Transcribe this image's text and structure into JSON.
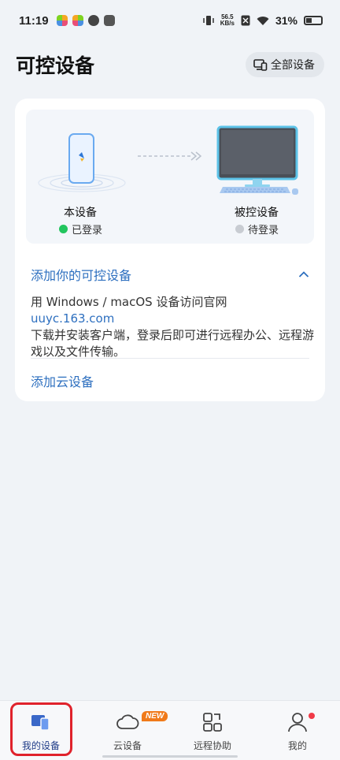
{
  "status_bar": {
    "time": "11:19",
    "net_speed_value": "56.5",
    "net_speed_unit": "KB/s",
    "battery": "31%"
  },
  "header": {
    "title": "可控设备",
    "all_devices_label": "全部设备"
  },
  "card": {
    "this_device_label": "本设备",
    "this_device_status": "已登录",
    "controlled_device_label": "被控设备",
    "controlled_device_status": "待登录",
    "add_controllable_title": "添加你的可控设备",
    "desc_prefix": "用 Windows / macOS 设备访问官网 ",
    "desc_link": "uuyc.163.com",
    "desc_suffix": "下载并安装客户端，登录后即可进行远程办公、远程游戏以及文件传输。",
    "add_cloud_label": "添加云设备"
  },
  "bottom_nav": {
    "items": [
      {
        "label": "我的设备"
      },
      {
        "label": "云设备"
      },
      {
        "label": "远程协助"
      },
      {
        "label": "我的"
      }
    ],
    "new_badge": "NEW"
  },
  "colors": {
    "accent": "#2d6fbf",
    "online": "#22c55e",
    "offline": "#c8ccd2",
    "badge": "#f07a1a",
    "highlight": "#e0222b"
  }
}
